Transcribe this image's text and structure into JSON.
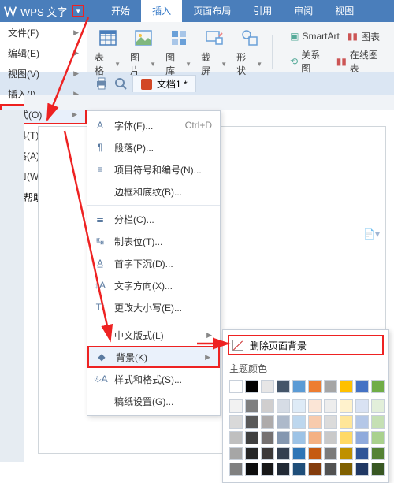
{
  "app": {
    "title": "WPS 文字"
  },
  "tabs": [
    "开始",
    "插入",
    "页面布局",
    "引用",
    "审阅",
    "视图"
  ],
  "tabs_active": 1,
  "ribbon_groups": [
    {
      "label": "表格",
      "dd": true
    },
    {
      "label": "图片",
      "dd": true
    },
    {
      "label": "图库",
      "dd": true
    },
    {
      "label": "截屏",
      "dd": true
    },
    {
      "label": "形状",
      "dd": true
    }
  ],
  "ribbon_right": {
    "smartart": "SmartArt",
    "chart": "图表",
    "relation": "关系图",
    "online_chart": "在线图表"
  },
  "left_menu": [
    {
      "label": "文件(F)",
      "arr": true
    },
    {
      "label": "编辑(E)",
      "arr": true
    },
    {
      "label": "视图(V)",
      "arr": true
    },
    {
      "label": "插入(I)",
      "arr": true
    },
    {
      "label": "格式(O)",
      "arr": true,
      "hl": true
    },
    {
      "label": "工具(T)",
      "arr": true
    },
    {
      "label": "表格(A)",
      "arr": true
    },
    {
      "label": "窗口(W)",
      "arr": true
    }
  ],
  "help_label": "帮助(H)",
  "doc_tab": "文档1 *",
  "submenu": {
    "items": [
      {
        "ico": "A",
        "label": "字体(F)...",
        "hot": "Ctrl+D"
      },
      {
        "ico": "¶",
        "label": "段落(P)..."
      },
      {
        "ico": "≡",
        "label": "项目符号和编号(N)..."
      },
      {
        "ico": "",
        "label": "边框和底纹(B)..."
      },
      {
        "sep": true
      },
      {
        "ico": "≣",
        "label": "分栏(C)..."
      },
      {
        "ico": "↹",
        "label": "制表位(T)..."
      },
      {
        "ico": "A̲",
        "label": "首字下沉(D)..."
      },
      {
        "ico": "↕A",
        "label": "文字方向(X)..."
      },
      {
        "ico": "Tt",
        "label": "更改大小写(E)..."
      },
      {
        "sep": true
      },
      {
        "ico": "",
        "label": "中文版式(L)",
        "arr": true
      },
      {
        "ico": "◆",
        "label": "背景(K)",
        "arr": true,
        "hl": true
      },
      {
        "ico": "⎀A",
        "label": "样式和格式(S)..."
      },
      {
        "ico": "",
        "label": "稿纸设置(G)..."
      }
    ]
  },
  "colorpanel": {
    "remove_label": "删除页面背景",
    "theme_label": "主题颜色",
    "row1": [
      "#ffffff",
      "#000000",
      "#e7e6e6",
      "#445569",
      "#5b9bd5",
      "#ed7d31",
      "#a5a5a5",
      "#ffc000",
      "#4472c4",
      "#70ad47"
    ],
    "tints": [
      [
        "#f2f2f2",
        "#7f7f7f",
        "#d0cece",
        "#d6dce5",
        "#deebf7",
        "#fbe5d6",
        "#ededed",
        "#fff2cc",
        "#d9e2f3",
        "#e2efda"
      ],
      [
        "#d9d9d9",
        "#595959",
        "#aeabab",
        "#adb9ca",
        "#bdd7ee",
        "#f8cbad",
        "#dbdbdb",
        "#ffe699",
        "#b4c7e7",
        "#c5e0b4"
      ],
      [
        "#bfbfbf",
        "#404040",
        "#757171",
        "#8497b0",
        "#9dc3e6",
        "#f4b183",
        "#c9c9c9",
        "#ffd966",
        "#8faadc",
        "#a9d18e"
      ],
      [
        "#a6a6a6",
        "#262626",
        "#3b3838",
        "#333f50",
        "#2e75b6",
        "#c55a11",
        "#7b7b7b",
        "#bf9000",
        "#2f5597",
        "#548235"
      ],
      [
        "#808080",
        "#0d0d0d",
        "#171717",
        "#222a35",
        "#1f4e79",
        "#843c0c",
        "#525252",
        "#806000",
        "#203864",
        "#385723"
      ]
    ]
  }
}
